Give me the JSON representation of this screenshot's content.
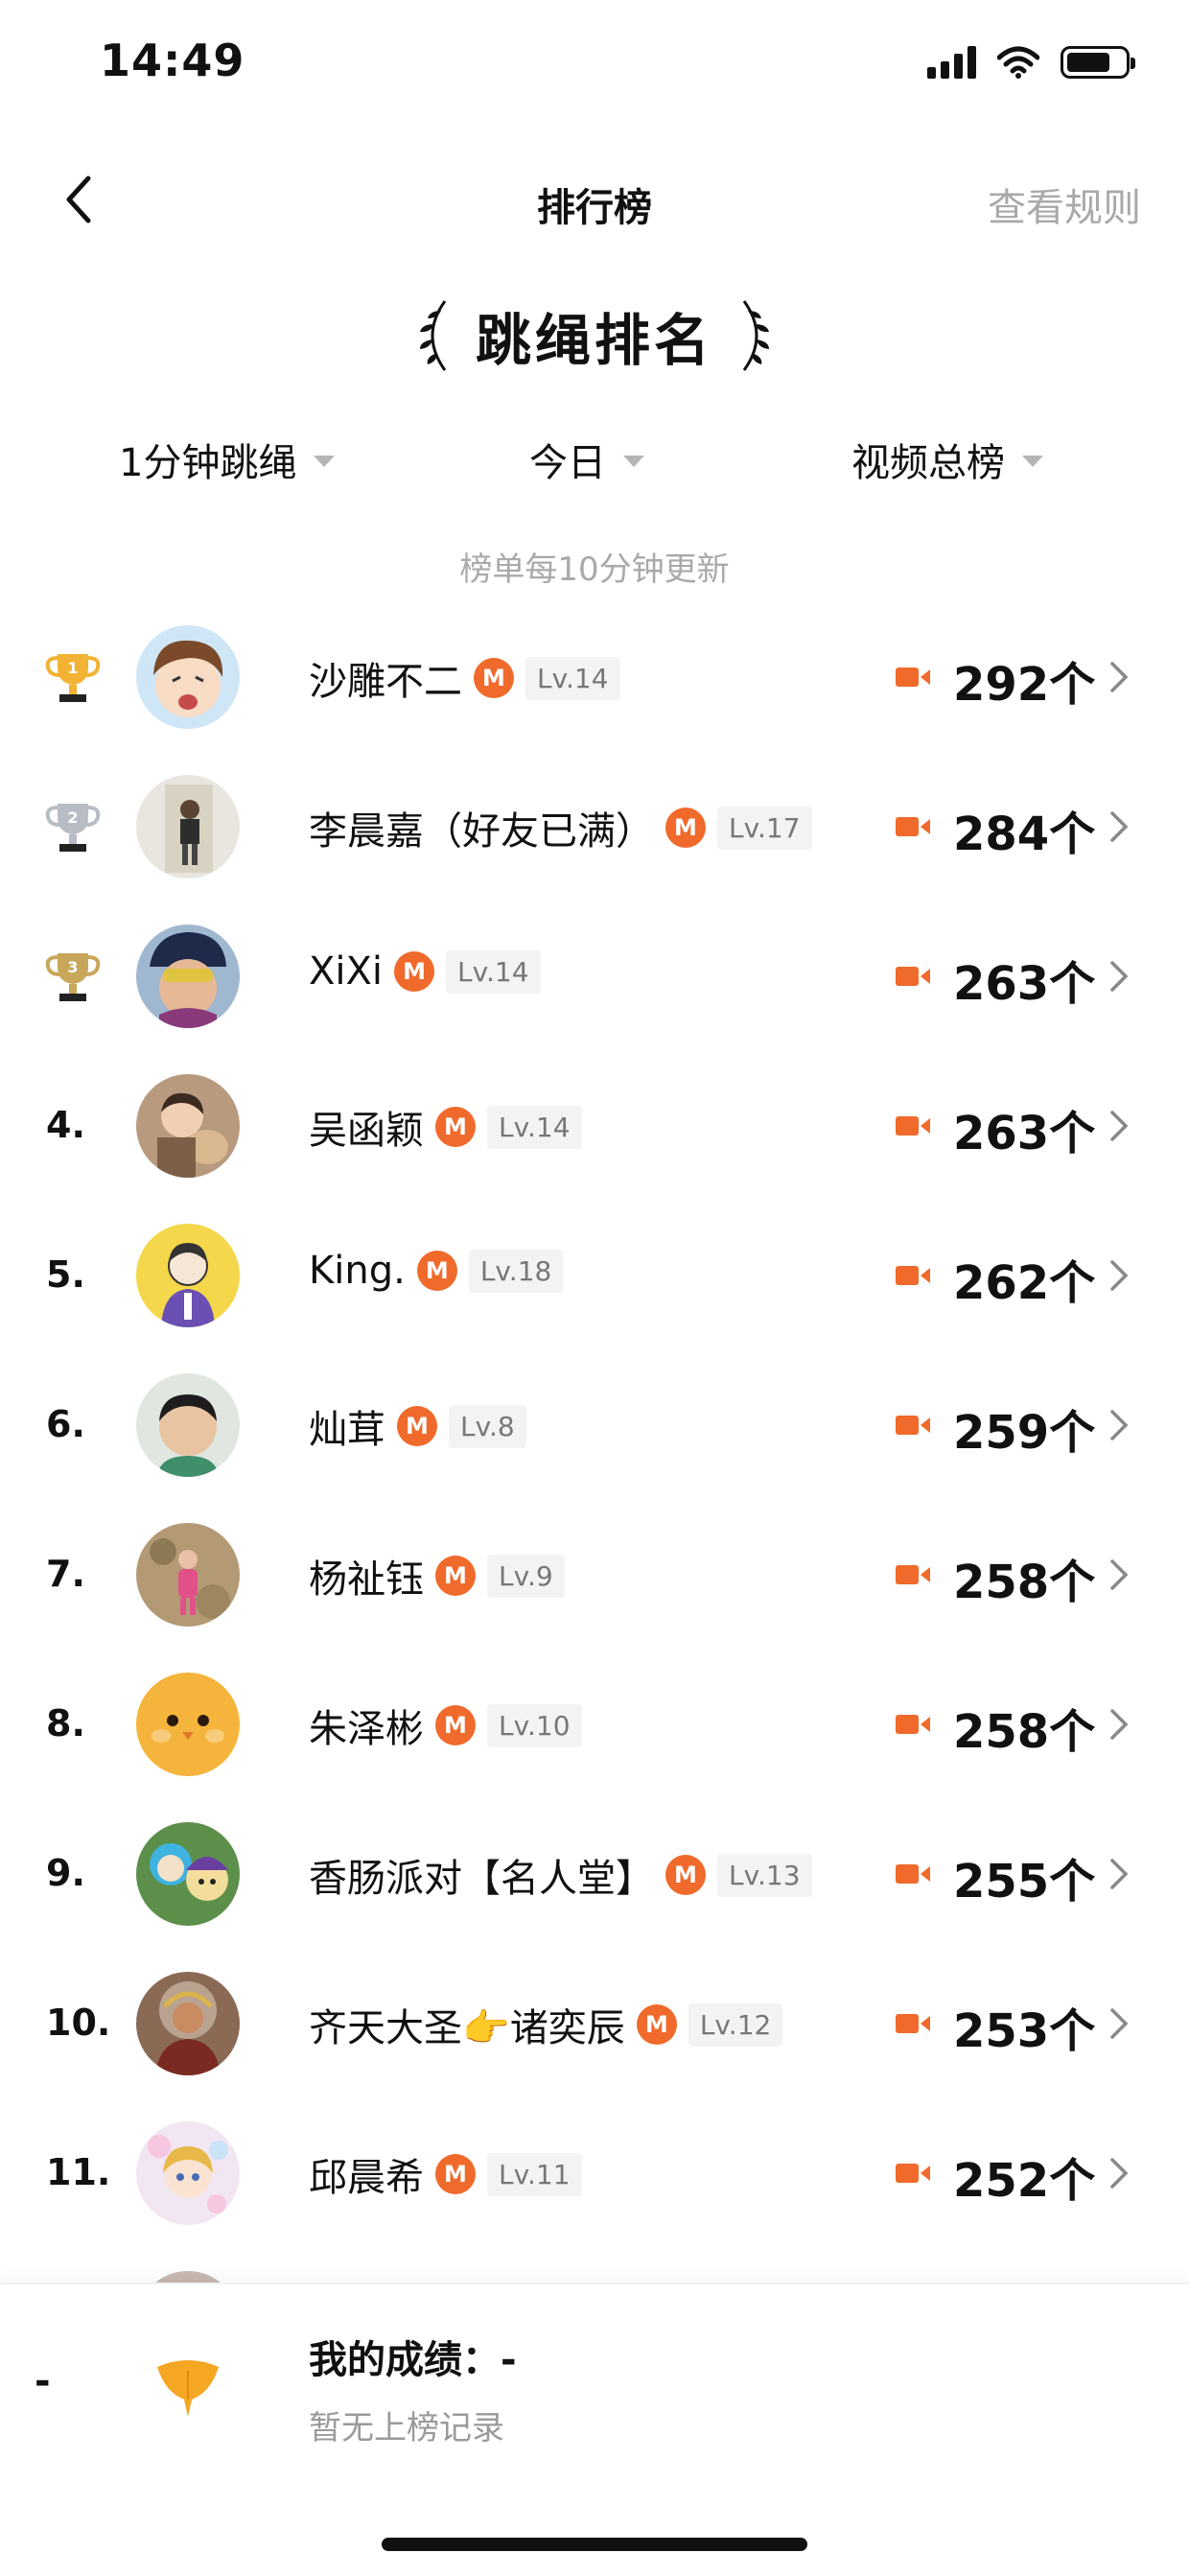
{
  "status_bar": {
    "time": "14:49"
  },
  "nav": {
    "title": "排行榜",
    "rules": "查看规则"
  },
  "header": {
    "title": "跳绳排名"
  },
  "filters": [
    {
      "label": "1分钟跳绳"
    },
    {
      "label": "今日"
    },
    {
      "label": "视频总榜"
    }
  ],
  "notice": "榜单每10分钟更新",
  "accent_color": "#f06a2b",
  "rankings": [
    {
      "rank": "1",
      "name": "沙雕不二",
      "badge": "M",
      "level": "Lv.14",
      "score": "292个",
      "trophy": "gold",
      "avatar": "cartoon-boy"
    },
    {
      "rank": "2",
      "name": "李晨嘉（好友已满）",
      "badge": "M",
      "level": "Lv.17",
      "score": "284个",
      "trophy": "silver",
      "avatar": "child-photo"
    },
    {
      "rank": "3",
      "name": "XiXi",
      "badge": "M",
      "level": "Lv.14",
      "score": "263个",
      "trophy": "bronze",
      "avatar": "kid-helmet"
    },
    {
      "rank": "4.",
      "name": "吴函颖",
      "badge": "M",
      "level": "Lv.14",
      "score": "263个",
      "avatar": "girl-photo"
    },
    {
      "rank": "5.",
      "name": "King.",
      "badge": "M",
      "level": "Lv.18",
      "score": "262个",
      "avatar": "yellow-cartoon"
    },
    {
      "rank": "6.",
      "name": "灿茸",
      "badge": "M",
      "level": "Lv.8",
      "score": "259个",
      "avatar": "boy-photo"
    },
    {
      "rank": "7.",
      "name": "杨祉钰",
      "badge": "M",
      "level": "Lv.9",
      "score": "258个",
      "avatar": "outdoor-photo"
    },
    {
      "rank": "8.",
      "name": "朱泽彬",
      "badge": "M",
      "level": "Lv.10",
      "score": "258个",
      "avatar": "chick-emoji"
    },
    {
      "rank": "9.",
      "name": "香肠派对【名人堂】",
      "badge": "M",
      "level": "Lv.13",
      "score": "255个",
      "avatar": "game-cartoon"
    },
    {
      "rank": "10.",
      "name": "齐天大圣👉诸奕辰",
      "badge": "M",
      "level": "Lv.12",
      "score": "253个",
      "avatar": "monkey-king"
    },
    {
      "rank": "11.",
      "name": "邱晨希",
      "badge": "M",
      "level": "Lv.11",
      "score": "252个",
      "avatar": "anime-girl"
    }
  ],
  "my_score": {
    "rank": "-",
    "title": "我的成绩：-",
    "subtitle": "暂无上榜记录"
  }
}
